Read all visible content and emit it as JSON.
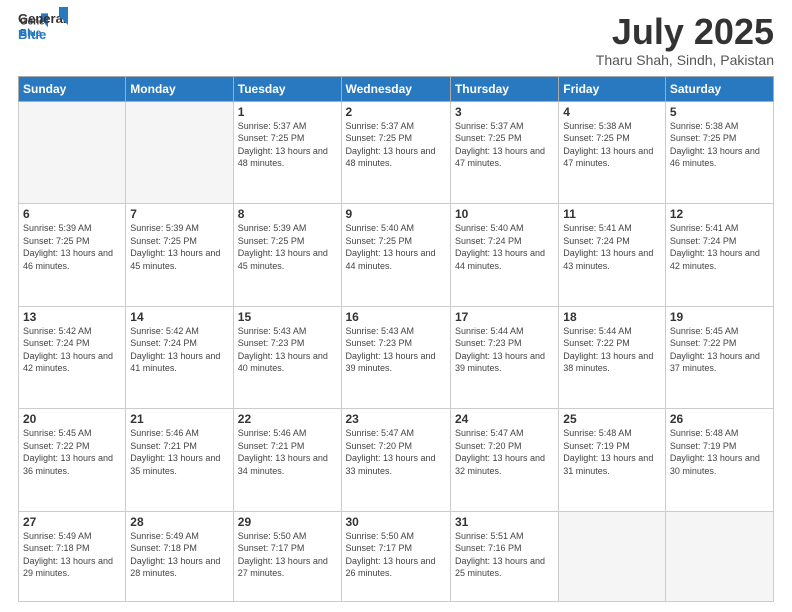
{
  "header": {
    "logo_line1": "General",
    "logo_line2": "Blue",
    "month": "July 2025",
    "location": "Tharu Shah, Sindh, Pakistan"
  },
  "days_of_week": [
    "Sunday",
    "Monday",
    "Tuesday",
    "Wednesday",
    "Thursday",
    "Friday",
    "Saturday"
  ],
  "weeks": [
    [
      {
        "day": "",
        "info": ""
      },
      {
        "day": "",
        "info": ""
      },
      {
        "day": "1",
        "info": "Sunrise: 5:37 AM\nSunset: 7:25 PM\nDaylight: 13 hours and 48 minutes."
      },
      {
        "day": "2",
        "info": "Sunrise: 5:37 AM\nSunset: 7:25 PM\nDaylight: 13 hours and 48 minutes."
      },
      {
        "day": "3",
        "info": "Sunrise: 5:37 AM\nSunset: 7:25 PM\nDaylight: 13 hours and 47 minutes."
      },
      {
        "day": "4",
        "info": "Sunrise: 5:38 AM\nSunset: 7:25 PM\nDaylight: 13 hours and 47 minutes."
      },
      {
        "day": "5",
        "info": "Sunrise: 5:38 AM\nSunset: 7:25 PM\nDaylight: 13 hours and 46 minutes."
      }
    ],
    [
      {
        "day": "6",
        "info": "Sunrise: 5:39 AM\nSunset: 7:25 PM\nDaylight: 13 hours and 46 minutes."
      },
      {
        "day": "7",
        "info": "Sunrise: 5:39 AM\nSunset: 7:25 PM\nDaylight: 13 hours and 45 minutes."
      },
      {
        "day": "8",
        "info": "Sunrise: 5:39 AM\nSunset: 7:25 PM\nDaylight: 13 hours and 45 minutes."
      },
      {
        "day": "9",
        "info": "Sunrise: 5:40 AM\nSunset: 7:25 PM\nDaylight: 13 hours and 44 minutes."
      },
      {
        "day": "10",
        "info": "Sunrise: 5:40 AM\nSunset: 7:24 PM\nDaylight: 13 hours and 44 minutes."
      },
      {
        "day": "11",
        "info": "Sunrise: 5:41 AM\nSunset: 7:24 PM\nDaylight: 13 hours and 43 minutes."
      },
      {
        "day": "12",
        "info": "Sunrise: 5:41 AM\nSunset: 7:24 PM\nDaylight: 13 hours and 42 minutes."
      }
    ],
    [
      {
        "day": "13",
        "info": "Sunrise: 5:42 AM\nSunset: 7:24 PM\nDaylight: 13 hours and 42 minutes."
      },
      {
        "day": "14",
        "info": "Sunrise: 5:42 AM\nSunset: 7:24 PM\nDaylight: 13 hours and 41 minutes."
      },
      {
        "day": "15",
        "info": "Sunrise: 5:43 AM\nSunset: 7:23 PM\nDaylight: 13 hours and 40 minutes."
      },
      {
        "day": "16",
        "info": "Sunrise: 5:43 AM\nSunset: 7:23 PM\nDaylight: 13 hours and 39 minutes."
      },
      {
        "day": "17",
        "info": "Sunrise: 5:44 AM\nSunset: 7:23 PM\nDaylight: 13 hours and 39 minutes."
      },
      {
        "day": "18",
        "info": "Sunrise: 5:44 AM\nSunset: 7:22 PM\nDaylight: 13 hours and 38 minutes."
      },
      {
        "day": "19",
        "info": "Sunrise: 5:45 AM\nSunset: 7:22 PM\nDaylight: 13 hours and 37 minutes."
      }
    ],
    [
      {
        "day": "20",
        "info": "Sunrise: 5:45 AM\nSunset: 7:22 PM\nDaylight: 13 hours and 36 minutes."
      },
      {
        "day": "21",
        "info": "Sunrise: 5:46 AM\nSunset: 7:21 PM\nDaylight: 13 hours and 35 minutes."
      },
      {
        "day": "22",
        "info": "Sunrise: 5:46 AM\nSunset: 7:21 PM\nDaylight: 13 hours and 34 minutes."
      },
      {
        "day": "23",
        "info": "Sunrise: 5:47 AM\nSunset: 7:20 PM\nDaylight: 13 hours and 33 minutes."
      },
      {
        "day": "24",
        "info": "Sunrise: 5:47 AM\nSunset: 7:20 PM\nDaylight: 13 hours and 32 minutes."
      },
      {
        "day": "25",
        "info": "Sunrise: 5:48 AM\nSunset: 7:19 PM\nDaylight: 13 hours and 31 minutes."
      },
      {
        "day": "26",
        "info": "Sunrise: 5:48 AM\nSunset: 7:19 PM\nDaylight: 13 hours and 30 minutes."
      }
    ],
    [
      {
        "day": "27",
        "info": "Sunrise: 5:49 AM\nSunset: 7:18 PM\nDaylight: 13 hours and 29 minutes."
      },
      {
        "day": "28",
        "info": "Sunrise: 5:49 AM\nSunset: 7:18 PM\nDaylight: 13 hours and 28 minutes."
      },
      {
        "day": "29",
        "info": "Sunrise: 5:50 AM\nSunset: 7:17 PM\nDaylight: 13 hours and 27 minutes."
      },
      {
        "day": "30",
        "info": "Sunrise: 5:50 AM\nSunset: 7:17 PM\nDaylight: 13 hours and 26 minutes."
      },
      {
        "day": "31",
        "info": "Sunrise: 5:51 AM\nSunset: 7:16 PM\nDaylight: 13 hours and 25 minutes."
      },
      {
        "day": "",
        "info": ""
      },
      {
        "day": "",
        "info": ""
      }
    ]
  ]
}
